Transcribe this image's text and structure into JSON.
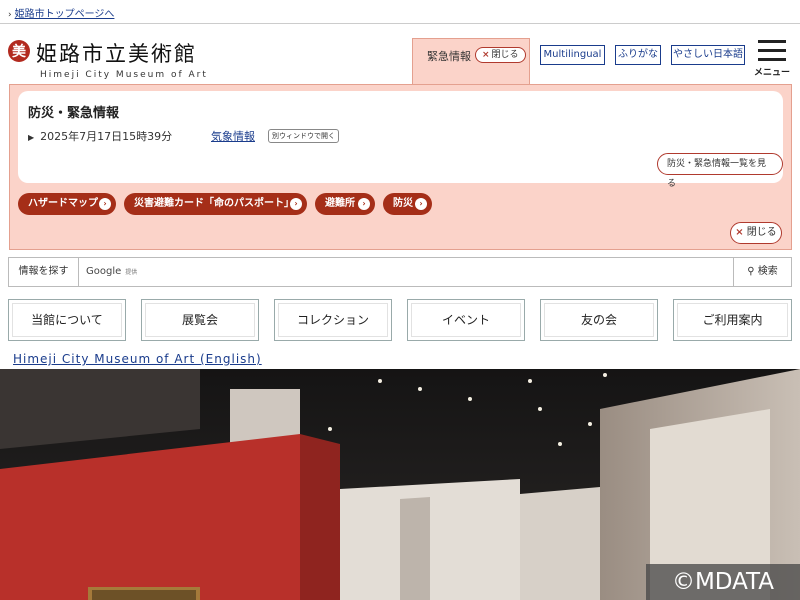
{
  "topbar": {
    "link": "姫路市トップページへ"
  },
  "header": {
    "logo_mark": "美",
    "title": "姫路市立美術館",
    "subtitle": "Himeji City Museum of Art",
    "emergency_tab": {
      "label": "緊急情報",
      "close": "閉じる"
    },
    "buttons": [
      "Multilingual",
      "ふりがな",
      "やさしい日本語"
    ],
    "menu_label": "メニュー"
  },
  "emergency": {
    "title": "防災・緊急情報",
    "date": "2025年7月17日15時39分",
    "weather_link": "気象情報",
    "new_window": "別ウィンドウで開く",
    "list_button": "防災・緊急情報一覧を見る",
    "pills": [
      "ハザードマップ",
      "災害避難カード「命のパスポート」",
      "避難所",
      "防災"
    ],
    "close": "閉じる"
  },
  "search": {
    "label": "情報を探す",
    "provider": "Google",
    "provider_note": "提供",
    "button": "検索"
  },
  "nav": [
    "当館について",
    "展覧会",
    "コレクション",
    "イベント",
    "友の会",
    "ご利用案内"
  ],
  "english_link": "Himeji City Museum of Art (English)",
  "watermark": "©MDATA",
  "colors": {
    "accent": "#a52e18",
    "emergency_bg": "#fbd3c9",
    "link": "#1a3c8c",
    "gallery_wall": "#b8302a"
  }
}
